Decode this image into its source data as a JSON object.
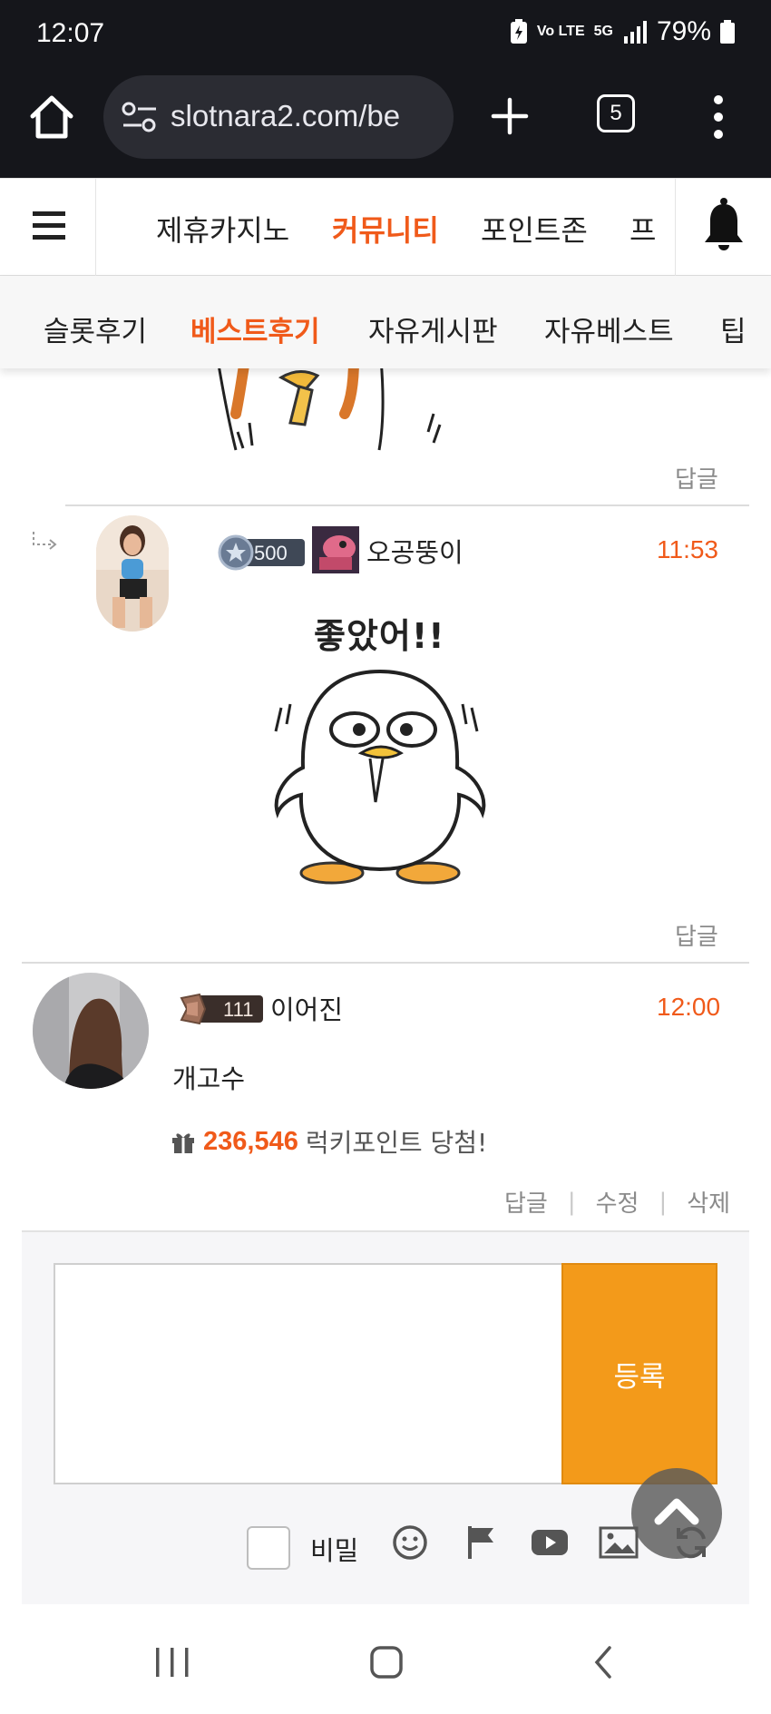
{
  "status_bar": {
    "time": "12:07",
    "network_label": "5G",
    "volte_label": "Vo LTE",
    "battery_percent": "79%"
  },
  "browser": {
    "url": "slotnara2.com/be",
    "tab_count": "5"
  },
  "site_nav": {
    "items": [
      {
        "label": "제휴카지노",
        "active": false
      },
      {
        "label": "커뮤니티",
        "active": true
      },
      {
        "label": "포인트존",
        "active": false
      },
      {
        "label": "프",
        "active": false
      }
    ]
  },
  "sub_nav": {
    "items": [
      {
        "label": "슬롯후기",
        "active": false
      },
      {
        "label": "베스트후기",
        "active": true
      },
      {
        "label": "자유게시판",
        "active": false
      },
      {
        "label": "자유베스트",
        "active": false
      },
      {
        "label": "팁",
        "active": false
      }
    ]
  },
  "comments": {
    "first_reply_label": "답글",
    "reply_comment": {
      "level": "500",
      "nickname": "오공뚱이",
      "time": "11:53",
      "sticker_text": "좋았어!!",
      "reply_label": "답글"
    },
    "main_comment": {
      "level": "111",
      "nickname": "이어진",
      "time": "12:00",
      "text": "개고수",
      "lucky_points": "236,546",
      "lucky_suffix": "럭키포인트 당첨!",
      "actions": {
        "reply": "답글",
        "edit": "수정",
        "delete": "삭제"
      }
    }
  },
  "comment_form": {
    "submit_label": "등록",
    "secret_label": "비밀",
    "tools": [
      "emoji-icon",
      "flag-icon",
      "youtube-icon",
      "image-icon",
      "refresh-icon"
    ]
  },
  "colors": {
    "accent": "#f05a1a",
    "submit": "#f39a1a",
    "browser_bg": "#15161b"
  }
}
